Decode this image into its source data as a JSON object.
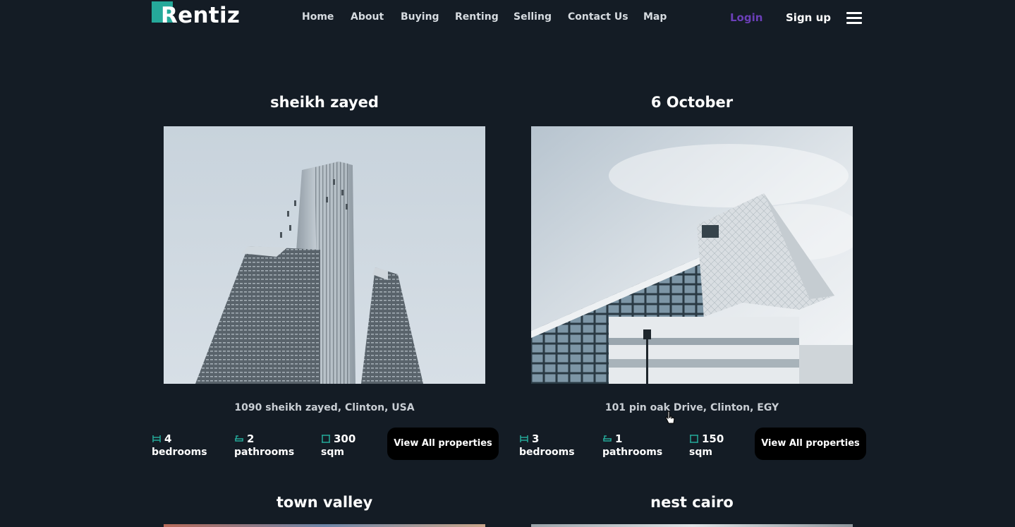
{
  "brand": {
    "name": "Rentiz",
    "accent": "#25a99a"
  },
  "nav": {
    "items": [
      "Home",
      "About",
      "Buying",
      "Renting",
      "Selling",
      "Contact Us",
      "Map"
    ]
  },
  "auth": {
    "login": "Login",
    "signup": "Sign up",
    "login_color": "#6b3fb8"
  },
  "listings": [
    {
      "title": "sheikh zayed",
      "address": "1090 sheikh zayed, Clinton, USA",
      "bedrooms": {
        "value": "4",
        "label": "bedrooms",
        "icon": "bed-icon"
      },
      "bathrooms": {
        "value": "2",
        "label": "pathrooms",
        "icon": "bath-icon"
      },
      "area": {
        "value": "300",
        "label": "sqm",
        "icon": "area-icon"
      },
      "button": "View All properties",
      "photo": "skyscraper-photo"
    },
    {
      "title": "6 October",
      "address": "101 pin oak Drive, Clinton, EGY",
      "bedrooms": {
        "value": "3",
        "label": "bedrooms",
        "icon": "bed-icon"
      },
      "bathrooms": {
        "value": "1",
        "label": "pathrooms",
        "icon": "bath-icon"
      },
      "area": {
        "value": "150",
        "label": "sqm",
        "icon": "area-icon"
      },
      "button": "View All properties",
      "photo": "modern-building-photo"
    }
  ],
  "more_listings": [
    {
      "title": "town valley"
    },
    {
      "title": "nest cairo"
    }
  ]
}
